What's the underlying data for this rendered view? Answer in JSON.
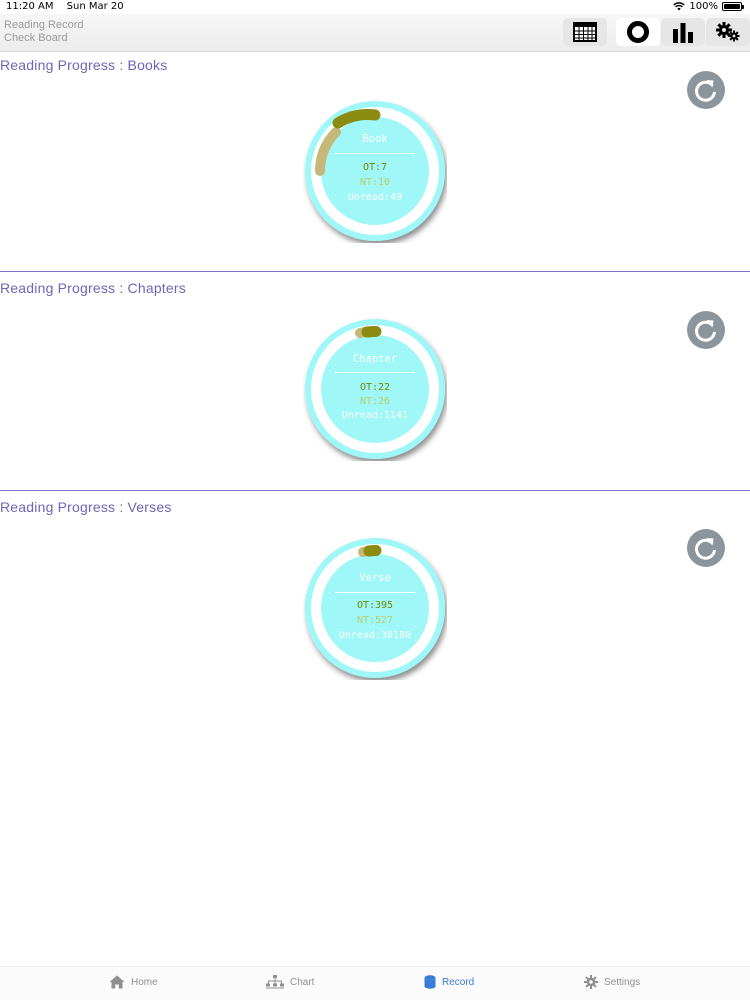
{
  "status_bar": {
    "time": "11:20 AM",
    "date": "Sun Mar 20",
    "battery": "100%"
  },
  "nav": {
    "title_line1": "Reading Record",
    "title_line2": "Check Board",
    "toolbar": [
      {
        "icon": "calendar-icon"
      },
      {
        "icon": "ring-icon",
        "active": true
      },
      {
        "icon": "bar-chart-icon"
      },
      {
        "icon": "gears-icon"
      }
    ]
  },
  "sections": [
    {
      "title": "Reading Progress : Books",
      "gauge": {
        "title": "Book",
        "ot": "OT:7",
        "nt": "NT:10",
        "unread": "Unread:49",
        "ot_value": 7,
        "nt_value": 10,
        "unread_value": 49
      }
    },
    {
      "title": "Reading Progress : Chapters",
      "gauge": {
        "title": "Chapter",
        "ot": "OT:22",
        "nt": "NT:26",
        "unread": "Unread:1141",
        "ot_value": 22,
        "nt_value": 26,
        "unread_value": 1141
      }
    },
    {
      "title": "Reading Progress : Verses",
      "gauge": {
        "title": "Verse",
        "ot": "OT:395",
        "nt": "NT:527",
        "unread": "Unread:30180",
        "ot_value": 395,
        "nt_value": 527,
        "unread_value": 30180
      }
    }
  ],
  "colors": {
    "gauge_bg": "#9ff7f7",
    "gauge_ring": "#ffffff",
    "ot_arc": "#8a8b10",
    "nt_arc": "#c6b879",
    "title": "#6d66b8",
    "active_tab": "#3a7bd5"
  },
  "tabs": [
    {
      "label": "Home",
      "icon": "home-icon"
    },
    {
      "label": "Chart",
      "icon": "sitemap-icon"
    },
    {
      "label": "Record",
      "icon": "database-icon",
      "active": true
    },
    {
      "label": "Settings",
      "icon": "gear-icon"
    }
  ]
}
